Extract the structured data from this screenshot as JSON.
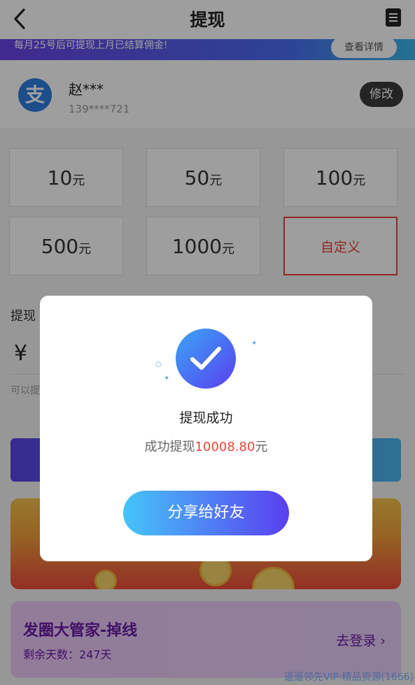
{
  "header": {
    "title": "提现"
  },
  "notice": {
    "text": "每月25号后可提现上月已结算佣金!",
    "button_label": "查看详情"
  },
  "account": {
    "badge_glyph": "支",
    "name": "赵***",
    "phone": "139****721",
    "edit_label": "修改"
  },
  "amounts": [
    {
      "value": "10",
      "unit": "元"
    },
    {
      "value": "50",
      "unit": "元"
    },
    {
      "value": "100",
      "unit": "元"
    },
    {
      "value": "500",
      "unit": "元"
    },
    {
      "value": "1000",
      "unit": "元"
    }
  ],
  "custom_amount_label": "自定义",
  "form": {
    "withdraw_label": "提现",
    "currency_symbol": "¥",
    "available_label": "可以提"
  },
  "promo": {
    "title": "发圈大管家-掉线",
    "days_label": "剩余天数：247天",
    "login_label": "去登录 ›"
  },
  "watermark": "遥遥领先VIP·精品资源(1666)",
  "modal": {
    "title": "提现成功",
    "desc_prefix": "成功提现",
    "desc_amount": "10008.80",
    "desc_suffix": "元",
    "share_label": "分享给好友"
  },
  "colors": {
    "accent_red": "#e5453b",
    "brand_purple": "#5a3ff0",
    "brand_blue": "#3aa6f5"
  },
  "icons": {
    "back": "chevron-left-icon",
    "menu": "document-icon",
    "check": "check-icon"
  }
}
